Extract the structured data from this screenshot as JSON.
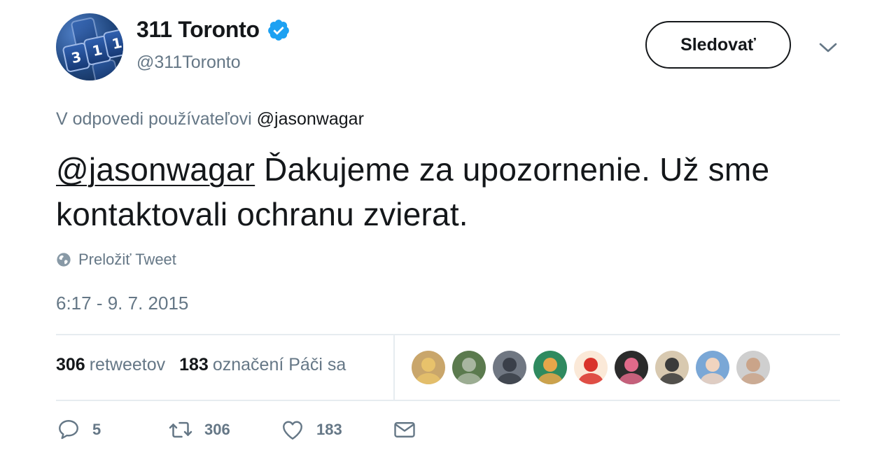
{
  "author": {
    "name": "311 Toronto",
    "handle": "@311Toronto",
    "verified": true,
    "avatar_keys": [
      "3",
      "1",
      "1"
    ]
  },
  "follow_button": {
    "label": "Sledovať"
  },
  "reply_context": {
    "prefix": "V odpovedi používateľovi",
    "mention": "@jasonwagar"
  },
  "tweet": {
    "mention": "@jasonwagar",
    "text": " Ďakujeme za upozornenie. Už sme kontaktovali ochranu zvierat."
  },
  "translate": {
    "label": "Preložiť Tweet",
    "icon": "globe-icon"
  },
  "timestamp": "6:17 - 9. 7. 2015",
  "stats": {
    "retweets_count": "306",
    "retweets_label": "retweetov",
    "likes_count": "183",
    "likes_label": "označení Páči sa"
  },
  "likers": [
    {
      "name": "liker-1",
      "bg": "#c9a66b",
      "fg": "#e8c26b"
    },
    {
      "name": "liker-2",
      "bg": "#5b7a4e",
      "fg": "#a8b6a0"
    },
    {
      "name": "liker-3",
      "bg": "#707782",
      "fg": "#3a3f49"
    },
    {
      "name": "liker-4",
      "bg": "#2f8a5f",
      "fg": "#e7a64a"
    },
    {
      "name": "liker-5",
      "bg": "#fbe9d8",
      "fg": "#d9332b"
    },
    {
      "name": "liker-6",
      "bg": "#2b2b2b",
      "fg": "#e06a8a"
    },
    {
      "name": "liker-7",
      "bg": "#d8c9b0",
      "fg": "#3b3b3b"
    },
    {
      "name": "liker-8",
      "bg": "#7aa7d6",
      "fg": "#f1d4bf"
    },
    {
      "name": "liker-9",
      "bg": "#cfcfcf",
      "fg": "#caa489"
    }
  ],
  "actions": {
    "reply_count": "5",
    "retweet_count": "306",
    "like_count": "183"
  },
  "colors": {
    "text": "#14171a",
    "muted": "#657786",
    "divider": "#e6ecf0",
    "verified": "#1da1f2"
  }
}
